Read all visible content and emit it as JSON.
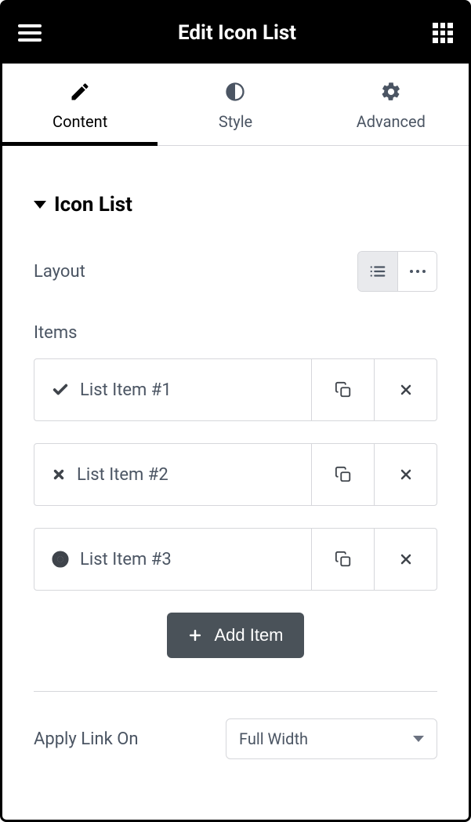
{
  "header": {
    "title": "Edit Icon List"
  },
  "tabs": {
    "content": "Content",
    "style": "Style",
    "advanced": "Advanced",
    "active": "content"
  },
  "section": {
    "title": "Icon List"
  },
  "layout": {
    "label": "Layout",
    "options": [
      "list",
      "inline"
    ],
    "selected": "list"
  },
  "items": {
    "label": "Items",
    "list": [
      {
        "icon": "check",
        "label": "List Item #1"
      },
      {
        "icon": "times",
        "label": "List Item #2"
      },
      {
        "icon": "dot-circle",
        "label": "List Item #3"
      }
    ]
  },
  "add_item": {
    "label": "Add Item"
  },
  "apply_link": {
    "label": "Apply Link On",
    "value": "Full Width"
  }
}
